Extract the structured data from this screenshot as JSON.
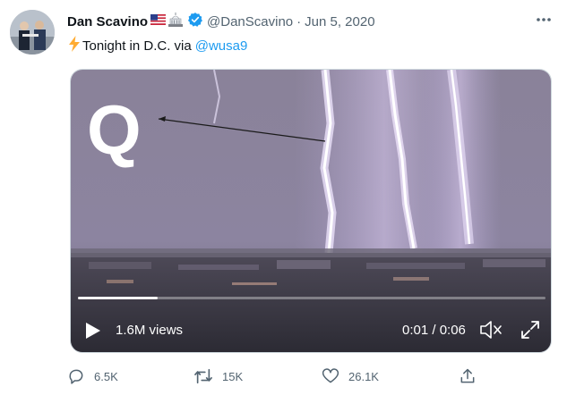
{
  "author": {
    "display_name": "Dan Scavino",
    "handle": "@DanScavino",
    "separator": "·",
    "date": "Jun 5, 2020"
  },
  "icons": {
    "avatar": "avatar-photo",
    "flag": "us-flag-icon",
    "emoji": "building-emoji-icon",
    "verified": "verified-badge-icon",
    "more": "more-dots-icon",
    "bolt": "lightning-bolt-icon",
    "play": "play-icon",
    "mute": "speaker-muted-icon",
    "fullscreen": "fullscreen-icon",
    "reply": "reply-icon",
    "retweet": "retweet-icon",
    "like": "heart-icon",
    "share": "share-icon"
  },
  "tweet": {
    "text": "Tonight in D.C. via",
    "mention": "@wusa9"
  },
  "media": {
    "overlay_letter": "Q",
    "views": "1.6M views",
    "time": "0:01 / 0:06",
    "progress": 0.17
  },
  "actions": {
    "replies": "6.5K",
    "retweets": "15K",
    "likes": "26.1K"
  },
  "colors": {
    "accent": "#1d9bf0",
    "secondary_text": "#536471",
    "verified": "#1d9bf0",
    "bolt": "#ffac33"
  }
}
